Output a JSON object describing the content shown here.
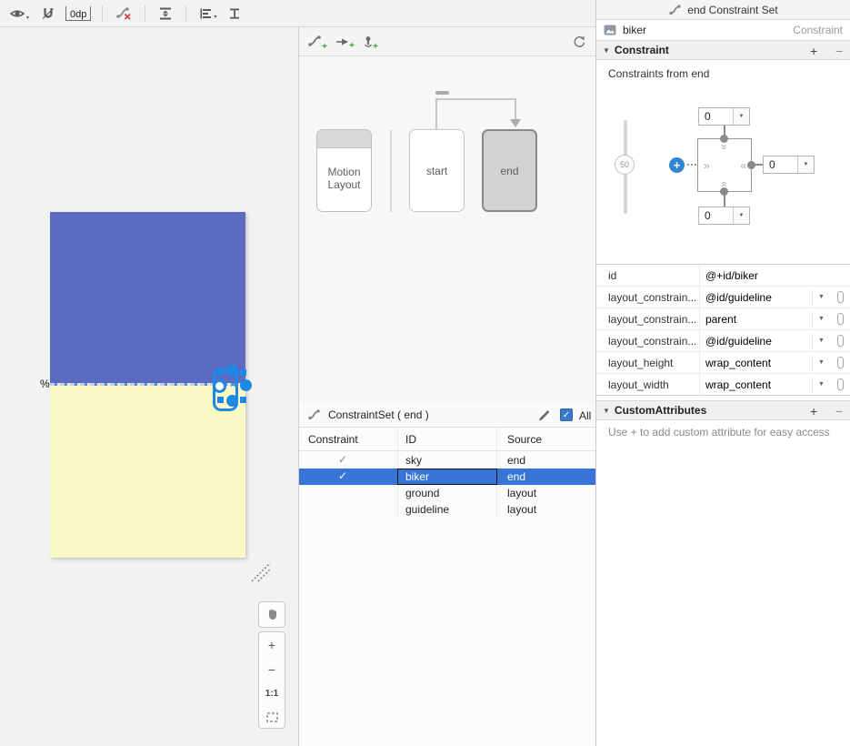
{
  "colors": {
    "selection_blue": "#3875D6",
    "accent_blue": "#2E86D3",
    "widget_selection_blue": "#1E88E5",
    "sky_view": "#5C6BC0",
    "ground_view": "#FBF8C8",
    "guideline_blue": "#4A8FE8"
  },
  "icons": {
    "expander": "▼",
    "dropdown_arrow": "▼",
    "caret": "▾",
    "check": "✓",
    "plus": "+",
    "spring_right": "»",
    "spring_left": "«",
    "x_mark": "×"
  },
  "left_toolbar": {
    "default_margin": "0dp"
  },
  "design_surface": {
    "guideline_percent_label": "%"
  },
  "zoom_controls": {
    "zoom_in_label": "+",
    "zoom_out_label": "−",
    "actual_size_label": "1:1"
  },
  "motion_panel": {
    "overview": {
      "motion_layout_line1": "Motion",
      "motion_layout_line2": "Layout",
      "start_label": "start",
      "end_label": "end"
    },
    "constraint_set_table": {
      "title": "ConstraintSet ( end )",
      "select_all_label": "All",
      "columns": [
        "Constraint",
        "ID",
        "Source"
      ],
      "rows": [
        {
          "check": "✓",
          "id": "sky",
          "source": "end"
        },
        {
          "check": "✓",
          "id": "biker",
          "source": "end"
        },
        {
          "check": "",
          "id": "ground",
          "source": "layout"
        },
        {
          "check": "",
          "id": "guideline",
          "source": "layout"
        }
      ]
    }
  },
  "attributes_panel": {
    "header_title": "end Constraint Set",
    "component_row": {
      "id": "biker",
      "kind": "Constraint"
    },
    "constraint_section": {
      "title": "Constraint",
      "add_label": "+",
      "remove_label": "−",
      "subtitle": "Constraints from end",
      "vertical_bias": "50",
      "margin_top": "0",
      "margin_end": "0",
      "margin_bottom": "0"
    },
    "properties_table": {
      "rows": [
        {
          "name": "id",
          "value": "@+id/biker"
        },
        {
          "name": "layout_constrain...",
          "value": "@id/guideline"
        },
        {
          "name": "layout_constrain...",
          "value": "parent"
        },
        {
          "name": "layout_constrain...",
          "value": "@id/guideline"
        },
        {
          "name": "layout_height",
          "value": "wrap_content"
        },
        {
          "name": "layout_width",
          "value": "wrap_content"
        }
      ]
    },
    "custom_attributes_section": {
      "title": "CustomAttributes",
      "add_label": "+",
      "remove_label": "−",
      "hint": "Use + to add custom attribute for easy access"
    }
  }
}
